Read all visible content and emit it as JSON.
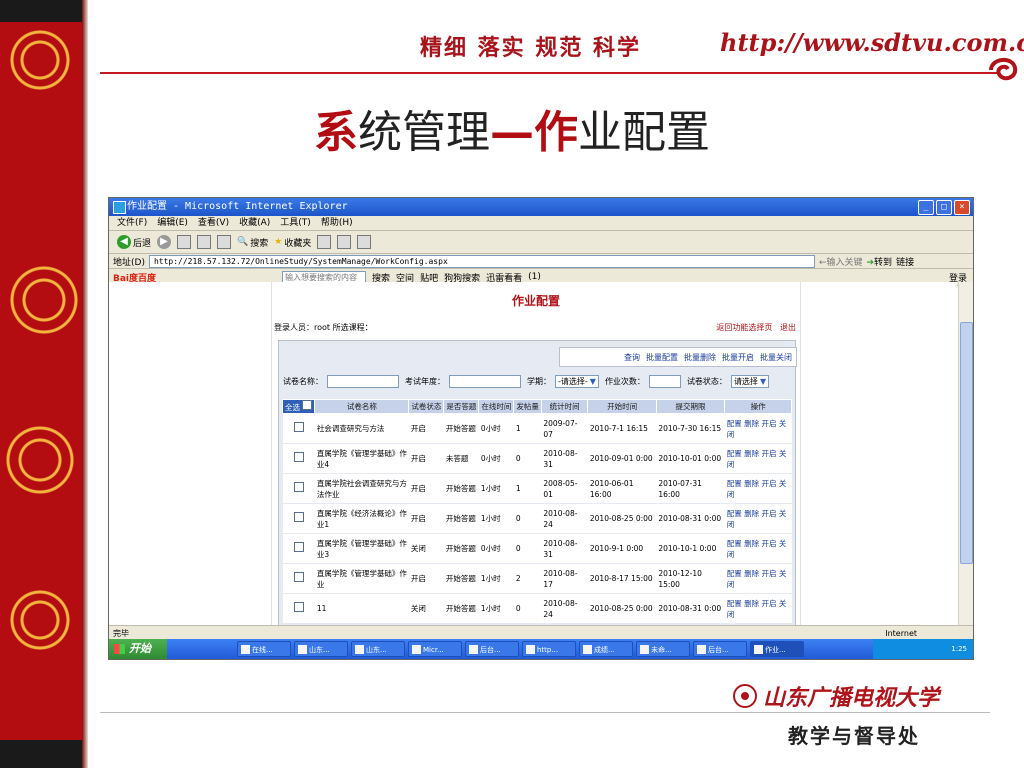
{
  "header": {
    "slogan": "精细  落实  规范  科学",
    "url": "http://www.sdtvu.com.cn"
  },
  "slide": {
    "title_part1": "系",
    "title_part2": "统管理",
    "title_part3": "—作",
    "title_part4": "业配置"
  },
  "window": {
    "title": "作业配置 - Microsoft Internet Explorer",
    "menu": [
      "文件(F)",
      "编辑(E)",
      "查看(V)",
      "收藏(A)",
      "工具(T)",
      "帮助(H)"
    ],
    "toolbar": {
      "back": "后退",
      "search": "搜索",
      "favorites": "收藏夹"
    },
    "address_label": "地址(D)",
    "address": "http://218.57.132.72/OnlineStudy/SystemManage/WorkConfig.aspx",
    "go": "转到",
    "links": "链接",
    "address_input": "←输入关键",
    "baidu": {
      "logo": "Bai度百度",
      "input": "输入想要搜索的内容",
      "search": "搜索",
      "space": "空间",
      "tieba": "贴吧",
      "sogou": "狗狗搜索",
      "xunlei": "迅雷看看",
      "count": "(1)",
      "login": "登录"
    },
    "status": "完毕",
    "zone": "Internet"
  },
  "page": {
    "title": "作业配置",
    "login_info": "登录人员：root  所选课程：",
    "return_link": "返回功能选择页",
    "exit_link": "退出",
    "actions": [
      "查询",
      "批量配置",
      "批量删除",
      "批量开启",
      "批量关闭"
    ],
    "filter": {
      "paper_name": "试卷名称：",
      "exam_year": "考试年度：",
      "semester": "学期：",
      "semester_value": "-请选择-",
      "work_times": "作业次数：",
      "paper_status": "试卷状态：",
      "status_value": "请选择"
    },
    "table": {
      "headers": [
        "全选",
        "试卷名称",
        "试卷状态",
        "是否答题",
        "在线时间",
        "发帖量",
        "统计时间",
        "开始时间",
        "提交期限",
        "操作"
      ],
      "rows": [
        {
          "name": "社会调查研究与方法",
          "status": "开启",
          "answer": "开始答题",
          "online": "0小时",
          "posts": "1",
          "stat": "2009-07-07",
          "start": "2010-7-1 16:15",
          "deadline": "2010-7-30 16:15"
        },
        {
          "name": "直属学院《管理学基础》作业4",
          "status": "开启",
          "answer": "未答题",
          "online": "0小时",
          "posts": "0",
          "stat": "2010-08-31",
          "start": "2010-09-01 0:00",
          "deadline": "2010-10-01 0:00"
        },
        {
          "name": "直属学院社会调查研究与方法作业",
          "status": "开启",
          "answer": "开始答题",
          "online": "1小时",
          "posts": "1",
          "stat": "2008-05-01",
          "start": "2010-06-01 16:00",
          "deadline": "2010-07-31 16:00"
        },
        {
          "name": "直属学院《经济法概论》作业1",
          "status": "开启",
          "answer": "开始答题",
          "online": "1小时",
          "posts": "0",
          "stat": "2010-08-24",
          "start": "2010-08-25 0:00",
          "deadline": "2010-08-31 0:00"
        },
        {
          "name": "直属学院《管理学基础》作业3",
          "status": "关闭",
          "answer": "开始答题",
          "online": "0小时",
          "posts": "0",
          "stat": "2010-08-31",
          "start": "2010-9-1 0:00",
          "deadline": "2010-10-1 0:00"
        },
        {
          "name": "直属学院《管理学基础》作业",
          "status": "开启",
          "answer": "开始答题",
          "online": "1小时",
          "posts": "2",
          "stat": "2010-08-17",
          "start": "2010-8-17 15:00",
          "deadline": "2010-12-10 15:00"
        },
        {
          "name": "11",
          "status": "关闭",
          "answer": "开始答题",
          "online": "1小时",
          "posts": "0",
          "stat": "2010-08-24",
          "start": "2010-08-25 0:00",
          "deadline": "2010-08-31 0:00"
        }
      ],
      "ops": {
        "config": "配置",
        "delete": "删除",
        "open": "开启",
        "close": "关闭"
      }
    }
  },
  "taskbar": {
    "start": "开始",
    "tasks": [
      "在线...",
      "山东...",
      "山东...",
      "Micr...",
      "后台...",
      "http...",
      "成绩...",
      "未命...",
      "后台...",
      "作业..."
    ],
    "clock": "1:25"
  },
  "footer": {
    "logo": "山东广播电视大学",
    "dept": "教学与督导处"
  },
  "colors": {
    "brand_red": "#b0141a",
    "xp_blue": "#225ad8"
  }
}
